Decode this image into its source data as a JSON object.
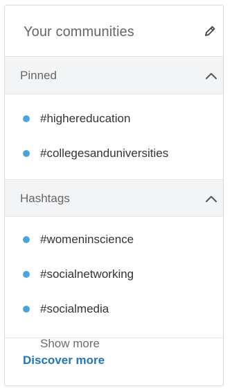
{
  "header": {
    "title": "Your communities",
    "edit_icon": "pencil-icon"
  },
  "pinned": {
    "title": "Pinned",
    "chevron_icon": "chevron-up-icon",
    "items": [
      {
        "label": "#highereducation"
      },
      {
        "label": "#collegesanduniversities"
      }
    ]
  },
  "hashtags": {
    "title": "Hashtags",
    "chevron_icon": "chevron-up-icon",
    "items": [
      {
        "label": "#womeninscience"
      },
      {
        "label": "#socialnetworking"
      },
      {
        "label": "#socialmedia"
      }
    ],
    "show_more": "Show more"
  },
  "footer": {
    "discover_label": "Discover more"
  },
  "colors": {
    "accent_dot": "#4aa6d9",
    "link": "#2277b5",
    "section_bg": "#f3f4f6"
  }
}
